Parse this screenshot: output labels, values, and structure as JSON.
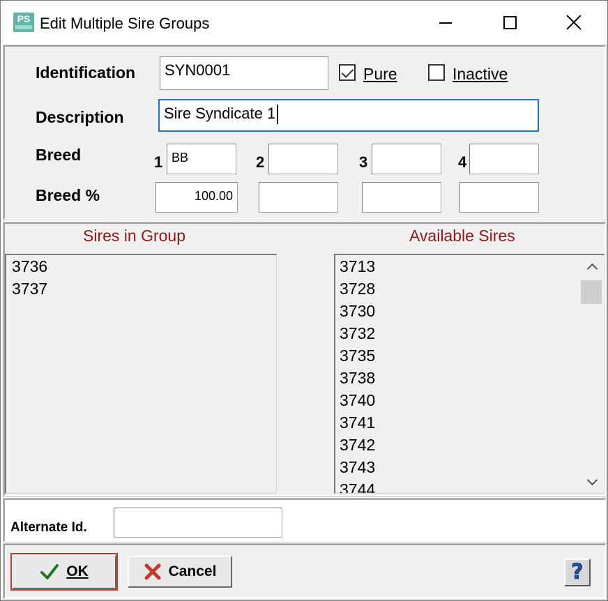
{
  "window": {
    "title": "Edit Multiple Sire Groups",
    "app_icon_text": "PS"
  },
  "form": {
    "identification_label": "Identification",
    "identification_value": "SYN0001",
    "pure_label": "Pure",
    "pure_checked": true,
    "inactive_label": "Inactive",
    "inactive_checked": false,
    "description_label": "Description",
    "description_value": "Sire Syndicate 1",
    "breed_label": "Breed",
    "breed_pct_label": "Breed %",
    "breed_numbers": [
      "1",
      "2",
      "3",
      "4"
    ],
    "breeds": [
      "BB",
      "",
      "",
      ""
    ],
    "breed_pcts": [
      "100.00",
      "",
      "",
      ""
    ]
  },
  "lists": {
    "sires_in_group_header": "Sires in Group",
    "available_sires_header": "Available Sires",
    "sires_in_group": [
      "3736",
      "3737"
    ],
    "available_sires": [
      "3713",
      "3728",
      "3730",
      "3732",
      "3735",
      "3738",
      "3740",
      "3741",
      "3742",
      "3743",
      "3744"
    ]
  },
  "alternate": {
    "label": "Alternate Id.",
    "value": ""
  },
  "buttons": {
    "ok_label": "OK",
    "cancel_label": "Cancel"
  },
  "colors": {
    "list_header": "#8b1a1a",
    "focus_border": "#1e73c8",
    "ok_icon": "#1f7a1f",
    "cancel_icon": "#c0392b",
    "help_icon": "#1f4fa0"
  },
  "icons": {
    "ok": "checkmark-icon",
    "cancel": "x-icon",
    "help": "question-icon"
  }
}
